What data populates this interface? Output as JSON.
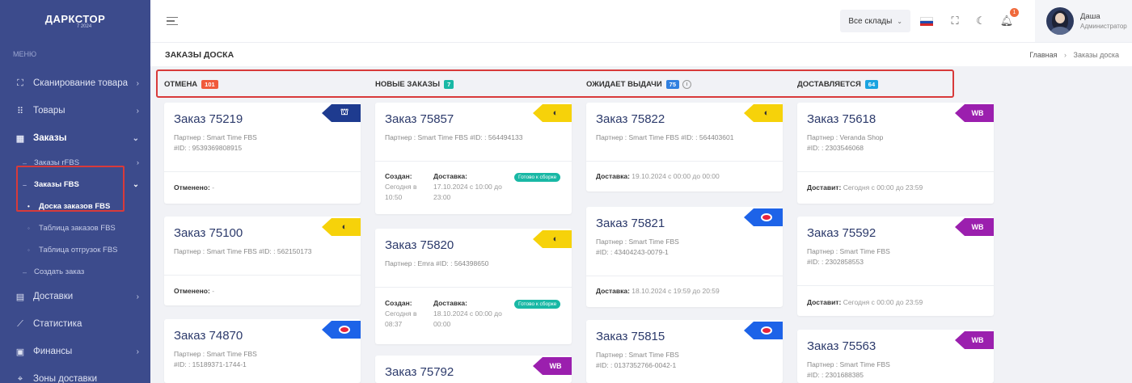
{
  "sidebar": {
    "logo": "ДАРКСТОР",
    "logo_sub": "7 2024",
    "menu_heading": "МЕНЮ",
    "items": [
      {
        "label": "Сканирование товара",
        "icon": "scan-icon"
      },
      {
        "label": "Товары",
        "icon": "grid-icon"
      },
      {
        "label": "Заказы",
        "icon": "orders-icon"
      },
      {
        "label": "Заказы rFBS"
      },
      {
        "label": "Заказы FBS"
      },
      {
        "label": "Доска заказов FBS"
      },
      {
        "label": "Таблица заказов FBS"
      },
      {
        "label": "Таблица отгрузок FBS"
      },
      {
        "label": "Создать заказ"
      },
      {
        "label": "Доставки",
        "icon": "delivery-icon"
      },
      {
        "label": "Статистика",
        "icon": "chart-icon"
      },
      {
        "label": "Финансы",
        "icon": "finance-icon"
      },
      {
        "label": "Зоны доставки",
        "icon": "zones-icon"
      }
    ]
  },
  "topbar": {
    "warehouse_select": "Все склады",
    "notification_count": "1",
    "user_name": "Даша",
    "user_role": "Администратор"
  },
  "page": {
    "title": "ЗАКАЗЫ ДОСКА",
    "breadcrumb_home": "Главная",
    "breadcrumb_current": "Заказы доска"
  },
  "columns": [
    {
      "title": "ОТМЕНА",
      "count": "101",
      "color": "#f05a3c"
    },
    {
      "title": "НОВЫЕ ЗАКАЗЫ",
      "count": "7",
      "color": "#19b8a5"
    },
    {
      "title": "ОЖИДАЕТ ВЫДАЧИ",
      "count": "75",
      "color": "#2f7fe0"
    },
    {
      "title": "ДОСТАВЛЯЕТСЯ",
      "count": "64",
      "color": "#1aa3e0"
    }
  ],
  "cards": {
    "c1": {
      "title": "Заказ 75219",
      "partner": "Партнер : Smart Time FBS",
      "id": "#ID: : 9539369808915",
      "foot_label": "Отменено:",
      "foot_value": "-"
    },
    "c2": {
      "title": "Заказ 75100",
      "partner": "Партнер : Smart Time FBS   #ID: : 562150173",
      "foot_label": "Отменено:",
      "foot_value": "-"
    },
    "c3": {
      "title": "Заказ 74870",
      "partner": "Партнер : Smart Time FBS",
      "id": "#ID: : 15189371-1744-1"
    },
    "n1": {
      "title": "Заказ 75857",
      "partner": "Партнер : Smart Time FBS   #ID: : 564494133",
      "created_label": "Создан:",
      "created_value_1": "Сегодня в",
      "created_value_2": "10:50",
      "delivery_label": "Доставка:",
      "delivery_value_1": "17.10.2024 с 10:00 до",
      "delivery_value_2": "23:00",
      "status": "Готово к сборке"
    },
    "n2": {
      "title": "Заказ 75820",
      "partner": "Партнер : Emra   #ID: : 564398650",
      "created_label": "Создан:",
      "created_value_1": "Сегодня в",
      "created_value_2": "08:37",
      "delivery_label": "Доставка:",
      "delivery_value_1": "18.10.2024 с 00:00 до",
      "delivery_value_2": "00:00",
      "status": "Готово к сборке"
    },
    "n3": {
      "title": "Заказ 75792",
      "tag": "WB"
    },
    "w1": {
      "title": "Заказ 75822",
      "partner": "Партнер : Smart Time FBS   #ID: : 564403601",
      "foot_label": "Доставка:",
      "foot_value": "19.10.2024 с 00:00 до 00:00"
    },
    "w2": {
      "title": "Заказ 75821",
      "partner": "Партнер : Smart Time FBS",
      "id": "#ID: : 43404243-0079-1",
      "foot_label": "Доставка:",
      "foot_value": "18.10.2024 с 19:59 до 20:59"
    },
    "w3": {
      "title": "Заказ 75815",
      "partner": "Партнер : Smart Time FBS",
      "id": "#ID: : 0137352766-0042-1"
    },
    "d1": {
      "title": "Заказ 75618",
      "partner": "Партнер : Veranda Shop",
      "id": "#ID: : 2303546068",
      "foot_label": "Доставит:",
      "foot_value": "Сегодня с 00:00 до 23:59",
      "tag": "WB"
    },
    "d2": {
      "title": "Заказ 75592",
      "partner": "Партнер : Smart Time FBS",
      "id": "#ID: : 2302858553",
      "foot_label": "Доставит:",
      "foot_value": "Сегодня с 00:00 до 23:59",
      "tag": "WB"
    },
    "d3": {
      "title": "Заказ 75563",
      "partner": "Партнер : Smart Time FBS",
      "id": "#ID: : 2301688385",
      "tag": "WB"
    }
  },
  "colors": {
    "sidebar": "#3c4b8c",
    "highlight": "#d83a3a",
    "card_title": "#2c3a6b",
    "tag_yellow": "#f6d20a",
    "tag_blue": "#1d63e8",
    "tag_purple": "#9b1fae"
  }
}
